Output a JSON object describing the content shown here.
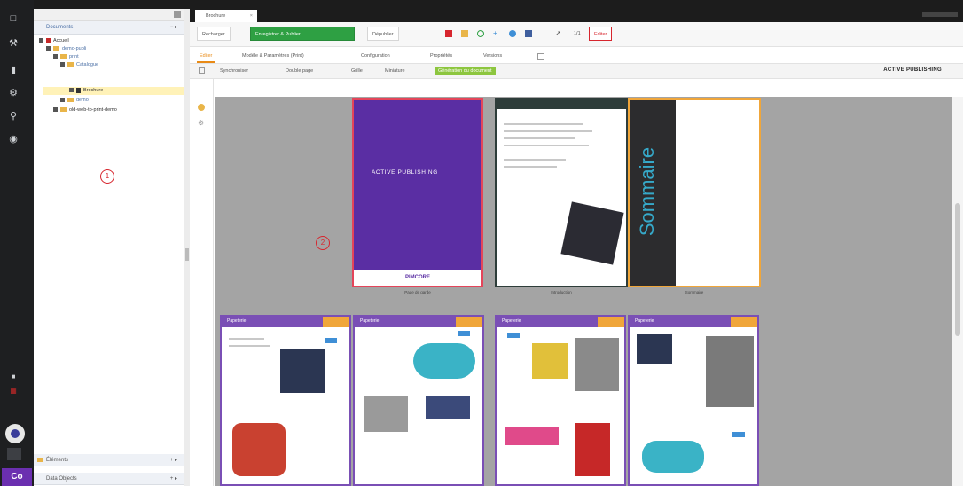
{
  "colors": {
    "accent": "#2ea043",
    "annotation": "#d7262e",
    "cover_purple": "#5a2ea3",
    "orange": "#f0a63a",
    "brand_purple": "#6b2fb0"
  },
  "rail": {
    "icons": [
      "file-icon",
      "wrench-icon",
      "chart-icon",
      "gear-icon",
      "search-icon",
      "eye-icon"
    ],
    "bottom_label": "Co"
  },
  "tree": {
    "header": "Documents",
    "header_ctrl": "− ▸",
    "nodes": [
      "Accueil",
      "demo-publi",
      "print",
      "Catalogue",
      "Brochure",
      "demo",
      "old-web-to-print-demo"
    ],
    "elements": "Éléments",
    "elements_ctrl": "+ ▸",
    "data_objects": "Data Objects",
    "data_objects_ctrl": "+ ▸"
  },
  "annotations": {
    "one": "1",
    "two": "2"
  },
  "tab": {
    "label": "Brochure",
    "close": "×"
  },
  "toolbar": {
    "reload": "Recharger",
    "save_publish": "Enregistrer & Publier",
    "unpublish": "Dépublier",
    "other": "Editer",
    "count": "1/1"
  },
  "subtabs": [
    "Editer",
    "Modèle & Paramètres (Print)",
    "Configuration",
    "Propriétés",
    "Versions"
  ],
  "subtabs2": [
    "Synchroniser",
    "Double page",
    "Grille",
    "Miniature",
    "Génération du document"
  ],
  "brand": "ACTIVE PUBLISHING",
  "pages": {
    "cover_title": "ACTIVE PUBLISHING",
    "cover_footer": "PIMCORE",
    "cover_caption": "Page de garde",
    "intro_caption": "Introduction",
    "somm_word": "Sommaire",
    "somm_caption": "Sommaire",
    "cat_header": "Papeterie"
  }
}
